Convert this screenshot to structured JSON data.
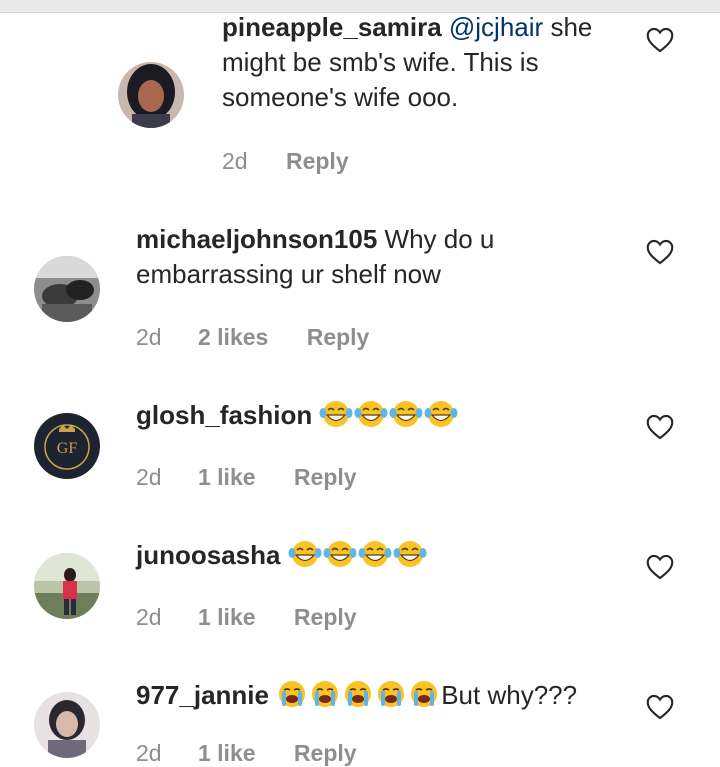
{
  "comments": [
    {
      "username": "pineapple_samira",
      "mention": "@jcjhair",
      "text": "she might be smb's wife. This is someone's wife ooo.",
      "time": "2d",
      "likes": "",
      "reply": "Reply"
    },
    {
      "username": "michaeljohnson105",
      "text": "Why do u embarrassing ur shelf now",
      "time": "2d",
      "likes": "2 likes",
      "reply": "Reply"
    },
    {
      "username": "glosh_fashion",
      "text": "",
      "emoji": [
        "tears-of-joy",
        "tears-of-joy",
        "tears-of-joy",
        "tears-of-joy"
      ],
      "time": "2d",
      "likes": "1 like",
      "reply": "Reply"
    },
    {
      "username": "junoosasha",
      "text": "",
      "emoji": [
        "tears-of-joy",
        "tears-of-joy",
        "tears-of-joy",
        "tears-of-joy"
      ],
      "time": "2d",
      "likes": "1 like",
      "reply": "Reply"
    },
    {
      "username": "977_jannie",
      "text": "But why???",
      "emoji": [
        "loudly-crying",
        "loudly-crying",
        "loudly-crying",
        "loudly-crying",
        "loudly-crying"
      ],
      "time": "2d",
      "likes": "1 like",
      "reply": "Reply"
    }
  ],
  "icons": {
    "like": "heart-outline-icon",
    "tears_of_joy": "tears-of-joy-emoji",
    "loudly_crying": "loudly-crying-emoji"
  },
  "colors": {
    "text": "#262626",
    "secondary": "#8e8e8e",
    "mention": "#003569",
    "emoji_face": "#f7c325"
  }
}
